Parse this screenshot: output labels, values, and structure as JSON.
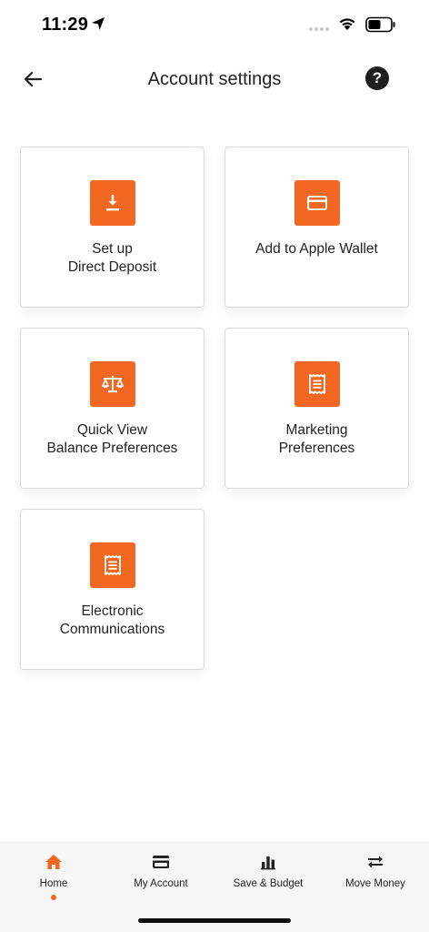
{
  "status_bar": {
    "time": "11:29"
  },
  "header": {
    "title": "Account settings",
    "help_label": "?"
  },
  "tiles": [
    {
      "line1": "Set up",
      "line2": "Direct Deposit",
      "icon": "download-icon"
    },
    {
      "line1": "Add to Apple Wallet",
      "line2": "",
      "icon": "card-icon"
    },
    {
      "line1": "Quick View",
      "line2": "Balance Preferences",
      "icon": "scale-icon"
    },
    {
      "line1": "Marketing",
      "line2": "Preferences",
      "icon": "document-icon"
    },
    {
      "line1": "Electronic",
      "line2": "Communications",
      "icon": "document-icon"
    }
  ],
  "bottom_nav": {
    "items": [
      {
        "label": "Home",
        "icon": "home-icon",
        "active": true
      },
      {
        "label": "My Account",
        "icon": "card-icon",
        "active": false
      },
      {
        "label": "Save & Budget",
        "icon": "bar-chart-icon",
        "active": false
      },
      {
        "label": "Move Money",
        "icon": "transfer-icon",
        "active": false
      }
    ]
  },
  "colors": {
    "accent": "#f26722",
    "text": "#222222",
    "nav_background": "#f6f6f6",
    "tile_border": "#dadada"
  }
}
